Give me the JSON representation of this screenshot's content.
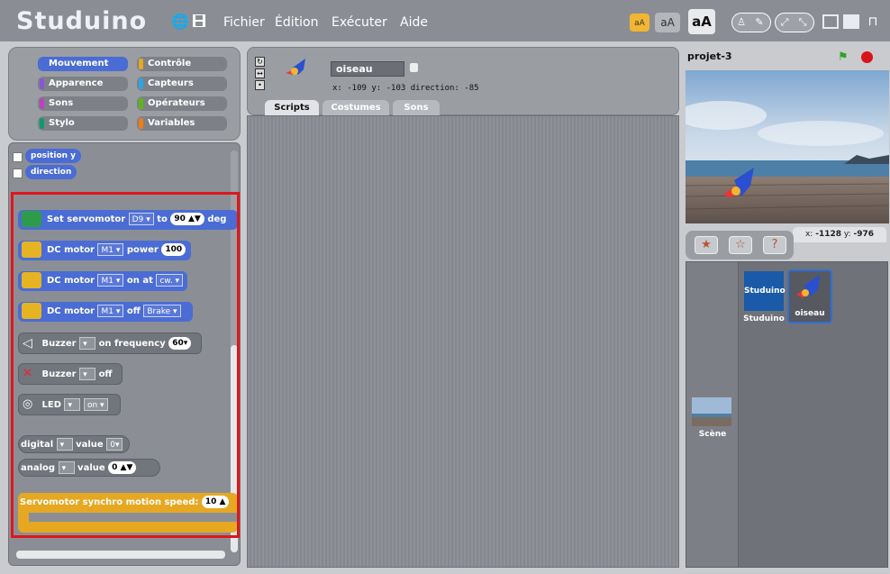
{
  "app": {
    "logo": "Studuino",
    "menu": [
      "Fichier",
      "Édition",
      "Exécuter",
      "Aide"
    ],
    "font_sizes": [
      "aA",
      "aA",
      "aA"
    ],
    "icons": [
      "globe-icon",
      "save-icon",
      "person-icon",
      "wrench-icon",
      "expand-icon",
      "shrink-icon",
      "layout-1-icon",
      "layout-2-icon",
      "presentation-icon"
    ]
  },
  "categories": [
    {
      "label": "Mouvement",
      "color": "#4a6cd4"
    },
    {
      "label": "Contrôle",
      "color": "#e6a822"
    },
    {
      "label": "Apparence",
      "color": "#8a55d7"
    },
    {
      "label": "Capteurs",
      "color": "#2ca5e2"
    },
    {
      "label": "Sons",
      "color": "#bb42c3"
    },
    {
      "label": "Opérateurs",
      "color": "#5cb712"
    },
    {
      "label": "Stylo",
      "color": "#0e9a6c"
    },
    {
      "label": "Variables",
      "color": "#ee7d16"
    }
  ],
  "blocks": {
    "position_y": "position y",
    "direction": "direction",
    "servo": {
      "label": "Set servomotor",
      "port": "D9",
      "to": "to",
      "value": "90",
      "suffix": "deg"
    },
    "dc_power": {
      "label": "DC motor",
      "port": "M1",
      "text": "power",
      "value": "100"
    },
    "dc_on": {
      "label": "DC motor",
      "port": "M1",
      "text": "on at",
      "dir": "cw."
    },
    "dc_off": {
      "label": "DC motor",
      "port": "M1",
      "text": "off",
      "mode": "Brake"
    },
    "buzzer_on": {
      "label": "Buzzer",
      "text": "on frequency",
      "value": "60"
    },
    "buzzer_off": {
      "label": "Buzzer",
      "text": "off"
    },
    "led": {
      "label": "LED",
      "state": "on"
    },
    "digital": {
      "label": "digital",
      "text": "value",
      "value": "0"
    },
    "analog": {
      "label": "analog",
      "text": "value",
      "value": "0"
    },
    "synchro": {
      "label": "Servomotor synchro motion speed:",
      "value": "10"
    }
  },
  "sprite": {
    "name": "oiseau",
    "coords": "x: -109  y: -103  direction: -85"
  },
  "tabs": [
    "Scripts",
    "Costumes",
    "Sons"
  ],
  "stage": {
    "title": "projet-3",
    "coords_x_label": "x:",
    "coords_x": "-1128",
    "coords_y_label": "y:",
    "coords_y": "-976"
  },
  "sprites": [
    {
      "name": "Studuino",
      "thumb": "Studuino"
    },
    {
      "name": "oiseau"
    }
  ],
  "scene_label": "Scène"
}
